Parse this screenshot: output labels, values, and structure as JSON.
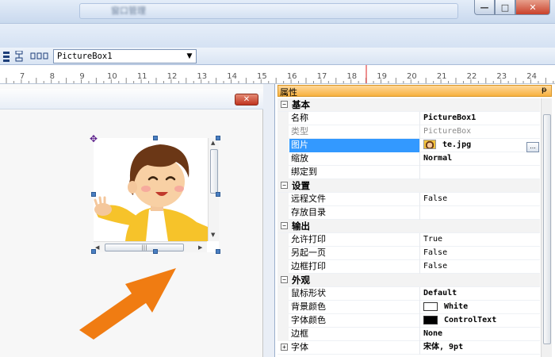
{
  "window": {
    "title": "窗口管理",
    "minimize_glyph": "—",
    "maximize_glyph": "□",
    "close_glyph": "✕"
  },
  "toolbar": {
    "control_combo_value": "PictureBox1",
    "combo_arrow": "▼"
  },
  "ruler": {
    "numbers": [
      "7",
      "8",
      "9",
      "10",
      "11",
      "12",
      "13",
      "14",
      "15",
      "16",
      "17",
      "18",
      "19",
      "20",
      "21",
      "22",
      "23",
      "24"
    ]
  },
  "design": {
    "panel_close_glyph": "✕",
    "scroll_thumb_grip": "|||",
    "scroll_up": "▲",
    "scroll_down": "▼",
    "scroll_left": "◀",
    "scroll_right": "▶",
    "move_glyph": "✥"
  },
  "properties": {
    "title": "属性",
    "pin_glyph": "ᵽ",
    "ellipsis": "...",
    "categories": {
      "basic": {
        "label": "基本",
        "toggle": "−"
      },
      "settings": {
        "label": "设置",
        "toggle": "−"
      },
      "output": {
        "label": "输出",
        "toggle": "−"
      },
      "appearance": {
        "label": "外观",
        "toggle": "−"
      }
    },
    "rows": {
      "name": {
        "label": "名称",
        "value": "PictureBox1"
      },
      "type": {
        "label": "类型",
        "value": "PictureBox"
      },
      "image": {
        "label": "图片",
        "value": "te.jpg"
      },
      "zoom": {
        "label": "缩放",
        "value": "Normal"
      },
      "bind": {
        "label": "绑定到",
        "value": ""
      },
      "remote_file": {
        "label": "远程文件",
        "value": "False"
      },
      "save_dir": {
        "label": "存放目录",
        "value": ""
      },
      "allow_print": {
        "label": "允许打印",
        "value": "True"
      },
      "new_page": {
        "label": "另起一页",
        "value": "False"
      },
      "border_print": {
        "label": "边框打印",
        "value": "False"
      },
      "cursor": {
        "label": "鼠标形状",
        "value": "Default"
      },
      "bg_color": {
        "label": "背景颜色",
        "value": "White"
      },
      "font_color": {
        "label": "字体颜色",
        "value": "ControlText"
      },
      "border": {
        "label": "边框",
        "value": "None"
      },
      "font": {
        "label": "字体",
        "value": "宋体, 9pt",
        "toggle": "+"
      }
    }
  },
  "colors": {
    "accent_header": "#f7b13e",
    "selection": "#3399ff",
    "arrow": "#f07c12",
    "bg_color_swatch": "#ffffff",
    "font_color_swatch": "#000000"
  }
}
